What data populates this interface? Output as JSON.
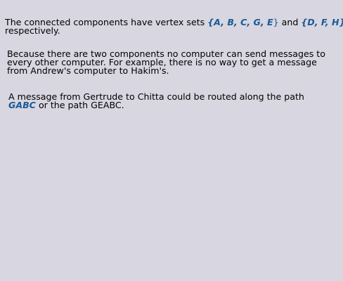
{
  "colors": {
    "background": "#d8d6e0",
    "text": "#000000",
    "highlight": "#1a5a96"
  },
  "paragraph1": {
    "line1_text": "The connected components have vertex sets ",
    "set1": "{A, B, C, G, E",
    "set1_close": "}",
    "middle": " and ",
    "set2": "{D, F, H}",
    "line2_text": "respectively."
  },
  "paragraph2": {
    "line1": "Because there are two components no computer can send messages to",
    "line2": "every other computer.  For example, there is no way to get a message",
    "line3": "from Andrew's computer to Hakim's."
  },
  "paragraph3": {
    "line1": "A message from Gertrude to Chitta could be routed along the path",
    "path1": "GABC",
    "line2_rest": " or the path GEABC."
  }
}
